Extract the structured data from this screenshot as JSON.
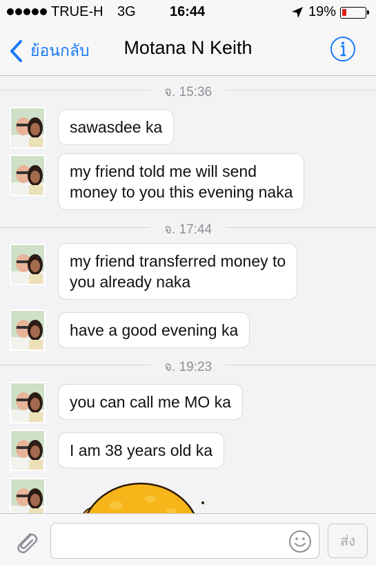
{
  "status_bar": {
    "carrier": "TRUE-H",
    "network": "3G",
    "time": "16:44",
    "battery": "19%",
    "battery_level": 0.19,
    "battery_color": "#e0201c"
  },
  "nav": {
    "back_label": "ย้อนกลับ",
    "title": "Motana N Keith",
    "accent_color": "#1a7af5"
  },
  "messages": {
    "timestamps": [
      "จ. 15:36",
      "จ. 17:44",
      "จ. 19:23"
    ],
    "items": [
      "sawasdee ka",
      "my friend told me will send\nmoney to you this evening naka",
      "my friend transferred money to\nyou already naka",
      "have a good evening ka",
      "you can call me MO ka",
      "I am 38 years old ka"
    ]
  },
  "input_bar": {
    "placeholder": "",
    "send_label": "ส่ง"
  },
  "icons": {
    "back": "chevron-left-icon",
    "info": "info-icon",
    "attach": "paperclip-icon",
    "emoji": "smiley-icon"
  }
}
